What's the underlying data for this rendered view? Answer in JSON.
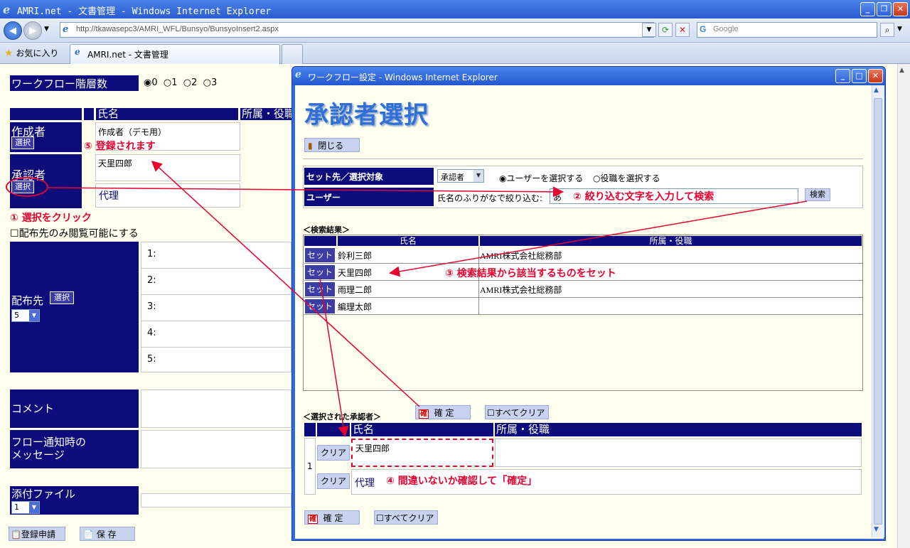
{
  "browser": {
    "title": "AMRI.net - 文書管理 - Windows Internet Explorer",
    "url": "http://tkawasepc3/AMRI_WFL/Bunsyo/BunsyoInsert2.aspx",
    "search_placeholder": "Google",
    "favorites_label": "お気に入り",
    "tab_label": "AMRI.net - 文書管理"
  },
  "main": {
    "workflow_label": "ワークフロー階層数",
    "workflow_options": [
      "0",
      "1",
      "2",
      "3"
    ],
    "col_name": "氏名",
    "col_dept": "所属・役職",
    "creator_label": "作成者",
    "creator_value": "作成者（デモ用）",
    "select_label": "選択",
    "approver_label": "承認者",
    "approver_value": "天里四郎",
    "proxy_label": "代理",
    "step1": "① 選択をクリック",
    "step5": "⑤ 登録されます",
    "checkbox_label": "配布先のみ閲覧可能にする",
    "distribution_label": "配布先",
    "distribution_count": "5",
    "distribution_rows": [
      "1:",
      "2:",
      "3:",
      "4:",
      "5:"
    ],
    "comment_label": "コメント",
    "flow_notice_label_1": "フロー通知時の",
    "flow_notice_label_2": "メッセージ",
    "attach_label": "添付ファイル",
    "attach_count": "1",
    "register_button": "登録申請",
    "save_button": "保 存"
  },
  "popup": {
    "title": "ワークフロー設定 - Windows Internet Explorer",
    "heading": "承認者選択",
    "close_button": "閉じる",
    "target_label": "セット先／選択対象",
    "target_value": "承認者",
    "radio_user": "ユーザーを選択する",
    "radio_position": "役職を選択する",
    "user_label": "ユーザー",
    "filter_label": "氏名のふりがなで絞り込む:",
    "filter_value": "あ",
    "search_button": "検索",
    "step2": "② 絞り込む文字を入力して検索",
    "results_label": "＜検索結果＞",
    "col_name": "氏名",
    "col_dept": "所属・役職",
    "set_label": "セット",
    "results": [
      {
        "name": "鈴利三郎",
        "dept": "AMRI株式会社総務部"
      },
      {
        "name": "天里四郎",
        "dept": ""
      },
      {
        "name": "雨理二郎",
        "dept": "AMRI株式会社総務部"
      },
      {
        "name": "編理太郎",
        "dept": ""
      }
    ],
    "step3": "③ 検索結果から該当するものをセット",
    "confirm_button": "確 定",
    "clear_all_button": "すべてクリア",
    "selected_label": "＜選択された承認者＞",
    "selected_index": "1",
    "clear_button": "クリア",
    "selected_name": "天里四郎",
    "proxy_label": "代理",
    "step4": "④ 間違いないか確認して「確定」"
  }
}
